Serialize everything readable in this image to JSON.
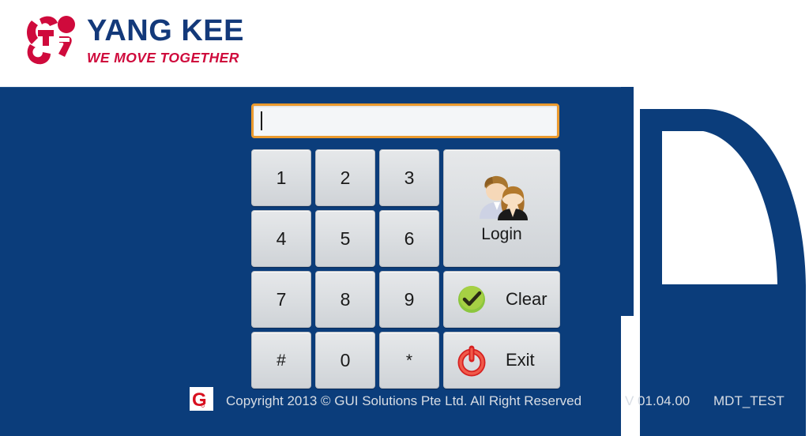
{
  "header": {
    "brand_name": "YANG KEE",
    "brand_tagline": "WE MOVE TOGETHER",
    "logo_icon": "yang-kee-logo-mark",
    "brand_color": "#13397a",
    "tagline_color": "#cf0a3c"
  },
  "theme": {
    "panel_blue": "#0b3d7b",
    "input_border_orange": "#eb9a2e",
    "key_face": "#dcdfe2"
  },
  "login": {
    "pin_value": "",
    "pin_placeholder": "",
    "keys": [
      {
        "label": "1",
        "name": "key-1"
      },
      {
        "label": "2",
        "name": "key-2"
      },
      {
        "label": "3",
        "name": "key-3"
      },
      {
        "label": "4",
        "name": "key-4"
      },
      {
        "label": "5",
        "name": "key-5"
      },
      {
        "label": "6",
        "name": "key-6"
      },
      {
        "label": "7",
        "name": "key-7"
      },
      {
        "label": "8",
        "name": "key-8"
      },
      {
        "label": "9",
        "name": "key-9"
      },
      {
        "label": "#",
        "name": "key-hash"
      },
      {
        "label": "0",
        "name": "key-0"
      },
      {
        "label": "*",
        "name": "key-star"
      }
    ],
    "login_button": {
      "label": "Login",
      "icon": "users-icon"
    },
    "clear_button": {
      "label": "Clear",
      "icon": "green-check-circle-icon"
    },
    "exit_button": {
      "label": "Exit",
      "icon": "red-power-icon"
    }
  },
  "footer": {
    "logo_icon": "gui-solutions-logo",
    "logo_letter": "G",
    "copyright": "Copyright 2013 © GUI Solutions Pte Ltd. All Right Reserved",
    "version": "V 01.04.00",
    "terminal": "MDT_TEST"
  },
  "graphics": {
    "truck_cab": "truck-cab-outline"
  }
}
